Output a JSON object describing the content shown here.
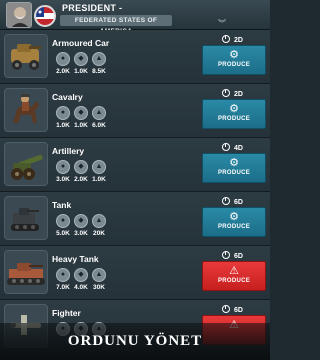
{
  "header": {
    "role": "PRESIDENT -",
    "nation": "FEDERATED STATES OF AMERICA",
    "chevron": "︾"
  },
  "units": [
    {
      "name": "Armoured Car",
      "duration": "2D",
      "resources": [
        "2.0K",
        "1.0K",
        "8.5K"
      ],
      "icons": [
        "food-icon",
        "fuel-icon",
        "metal-icon"
      ],
      "button": "PRODUCE",
      "status": "ok"
    },
    {
      "name": "Cavalry",
      "duration": "2D",
      "resources": [
        "1.0K",
        "1.0K",
        "6.0K"
      ],
      "icons": [
        "food-icon",
        "fuel-icon",
        "bullet-icon"
      ],
      "button": "PRODUCE",
      "status": "ok"
    },
    {
      "name": "Artillery",
      "duration": "4D",
      "resources": [
        "3.0K",
        "2.0K",
        "1.0K"
      ],
      "icons": [
        "food-icon",
        "fuel-icon",
        "metal-icon"
      ],
      "button": "PRODUCE",
      "status": "ok"
    },
    {
      "name": "Tank",
      "duration": "6D",
      "resources": [
        "5.0K",
        "3.0K",
        "20K"
      ],
      "icons": [
        "food-icon",
        "fuel-icon",
        "metal-icon"
      ],
      "button": "PRODUCE",
      "status": "ok"
    },
    {
      "name": "Heavy Tank",
      "duration": "6D",
      "resources": [
        "7.0K",
        "4.0K",
        "30K"
      ],
      "icons": [
        "food-icon",
        "fuel-icon",
        "metal-icon"
      ],
      "button": "PRODUCE",
      "status": "warning"
    },
    {
      "name": "Fighter",
      "duration": "6D",
      "resources": [
        "",
        "",
        ""
      ],
      "icons": [
        "food-icon",
        "fuel-icon",
        "metal-icon"
      ],
      "button": "",
      "status": "warning"
    }
  ],
  "footer": {
    "title": "ORDUNU YÖNET"
  },
  "colors": {
    "produce": "#1c6e88",
    "warning": "#d62828",
    "background": "#1f2a30"
  }
}
